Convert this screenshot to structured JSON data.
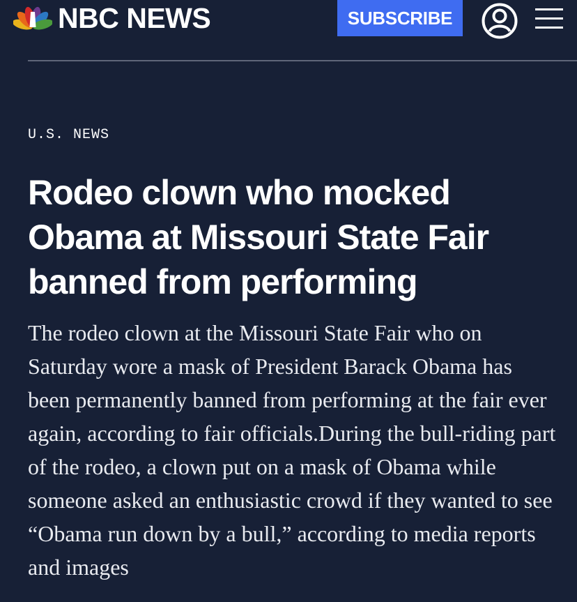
{
  "header": {
    "logo_text": "NBC NEWS",
    "subscribe_label": "SUBSCRIBE",
    "account_icon": "account-icon",
    "menu_icon": "hamburger-menu-icon"
  },
  "article": {
    "section": "U.S. NEWS",
    "headline": "Rodeo clown who mocked Obama at Missouri State Fair banned from performing",
    "summary": "The rodeo clown at the Missouri State Fair who on Saturday wore a mask of President Barack Obama has been permanently banned from performing at the fair ever again, according to fair officials.During the bull-riding part of the rodeo, a clown put on a mask of Obama while someone asked an enthusiastic crowd if they wanted to see “Obama run down by a bull,” according to media reports and images"
  },
  "colors": {
    "background": "#172036",
    "subscribe": "#3f6cf1",
    "divider": "#5f6679",
    "peacock": [
      "#e8b21c",
      "#e8681a",
      "#d32a2a",
      "#6d3a8f",
      "#2c78c2",
      "#4a9a3c"
    ]
  }
}
